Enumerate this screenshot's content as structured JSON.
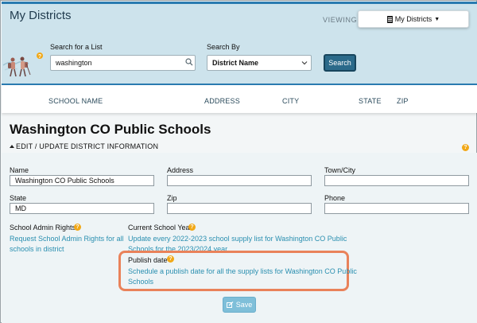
{
  "header": {
    "title": "My Districts",
    "viewing_label": "VIEWING:",
    "viewing_button": "My Districts",
    "viewing_icon": "building-icon"
  },
  "search": {
    "list_label": "Search for a List",
    "list_value": "washington",
    "by_label": "Search By",
    "by_value": "District Name",
    "button": "Search"
  },
  "results": {
    "columns": [
      "SCHOOL NAME",
      "ADDRESS",
      "CITY",
      "STATE",
      "ZIP"
    ]
  },
  "district": {
    "title": "Washington CO Public Schools",
    "edit_link": "EDIT / UPDATE DISTRICT INFORMATION",
    "fields": {
      "name_label": "Name",
      "name_value": "Washington CO Public Schools",
      "address_label": "Address",
      "address_value": "",
      "town_label": "Town/City",
      "town_value": "",
      "state_label": "State",
      "state_value": "MD",
      "zip_label": "Zip",
      "zip_value": "",
      "phone_label": "Phone",
      "phone_value": ""
    },
    "admin_rights": {
      "heading": "School Admin Rights",
      "link_line1": "Request School Admin Rights for all",
      "link_line2": "schools in district"
    },
    "school_year": {
      "heading": "Current School Year",
      "link_line1": "Update every 2022-2023 school supply list for Washington CO Public",
      "link_line2": "Schools for the 2023/2024 year."
    },
    "publish": {
      "heading": "Publish date",
      "link_line1": "Schedule a publish date for all the supply lists for Washington CO Public",
      "link_line2": "Schools"
    },
    "save_button": "Save"
  },
  "colors": {
    "header_bg": "#cde3ec",
    "accent": "#2a7bb0",
    "search_button": "#2b6a8a",
    "link": "#2a8fb0",
    "help_badge": "#f1a817",
    "highlight": "#e9825a",
    "save_button": "#7fbfd9"
  }
}
